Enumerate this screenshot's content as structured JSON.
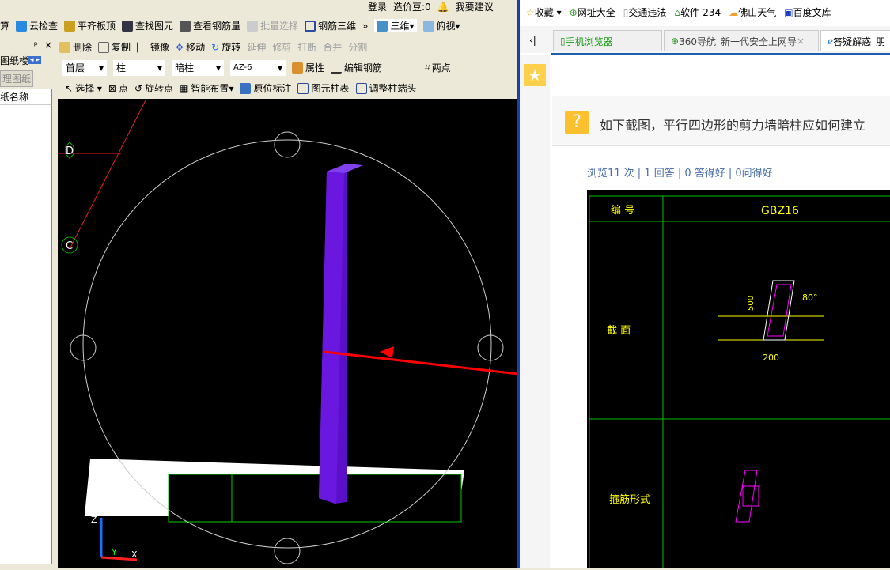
{
  "app": {
    "top_right": {
      "login": "登录",
      "price_beans": "造价豆:0",
      "suggest": "我要建议"
    },
    "toolbar1": [
      "算",
      "云检查",
      "平齐板顶",
      "查找图元",
      "查看钢筋量",
      "批量选择",
      "钢筋三维"
    ],
    "toolbar1_view": {
      "threed": "三维",
      "top_view": "俯视"
    },
    "toolbar2": [
      "删除",
      "复制",
      "镜像",
      "移动",
      "旋转",
      "延伸",
      "修剪",
      "打断",
      "合并",
      "分割"
    ],
    "toolbar3": {
      "floor": "首层",
      "category": "柱",
      "type": "暗柱",
      "name": "AZ-6",
      "property": "属性",
      "edit_rebar": "编辑钢筋",
      "two_points": "两点"
    },
    "toolbar4": [
      "选择",
      "点",
      "旋转点",
      "智能布置",
      "原位标注",
      "图元柱表",
      "调整柱端头"
    ],
    "left_panel": {
      "tab": "图纸楼",
      "button": "理图纸",
      "column": "纸名称"
    },
    "axis_labels": {
      "d": "D",
      "c": "C",
      "z": "Z",
      "y": "Y",
      "x": "X"
    }
  },
  "browser": {
    "bookmarks": [
      "收藏",
      "网址大全",
      "交通违法",
      "软件-234",
      "佛山天气",
      "百度文库"
    ],
    "tabs": [
      "手机浏览器",
      "360导航_新一代安全上网导",
      "答疑解惑_朋"
    ],
    "question": "如下截图，平行四边形的剪力墙暗柱应如何建立",
    "stats": "浏览11 次 | 1 回答 | 0 答得好 | 0问得好",
    "cad": {
      "header_left": "编 号",
      "header_right": "GBZ16",
      "row1": "截 面",
      "row2": "箍筋形式",
      "dim1": "500",
      "dim2": "200",
      "angle": "80°"
    }
  },
  "colors": {
    "column": "#5a10c8",
    "cad_grid": "#00c000",
    "cad_text": "#ffff00",
    "arrow": "#ff0000",
    "divider": "#1a3fb0"
  }
}
